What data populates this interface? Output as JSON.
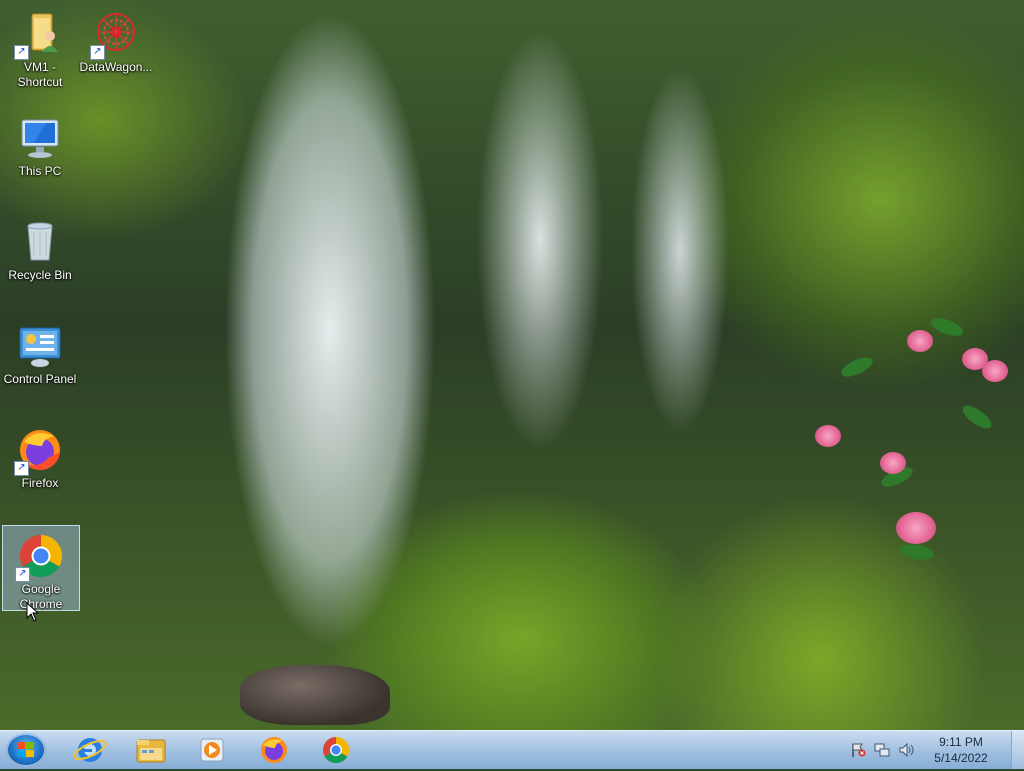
{
  "desktop": {
    "icons": [
      {
        "label": "VM1 - Shortcut",
        "icon": "folder-user-icon",
        "shortcut": true
      },
      {
        "label": "DataWagon...",
        "icon": "datawagon-icon",
        "shortcut": true
      },
      {
        "label": "This PC",
        "icon": "computer-monitor-icon",
        "shortcut": false
      },
      {
        "label": "Recycle Bin",
        "icon": "recycle-bin-icon",
        "shortcut": false
      },
      {
        "label": "Control Panel",
        "icon": "control-panel-icon",
        "shortcut": false
      },
      {
        "label": "Firefox",
        "icon": "firefox-icon",
        "shortcut": true
      },
      {
        "label": "Google Chrome",
        "icon": "chrome-icon",
        "shortcut": true,
        "selected": true
      }
    ]
  },
  "taskbar": {
    "pinned": [
      {
        "name": "internet-explorer",
        "icon": "internet-explorer-icon"
      },
      {
        "name": "file-explorer",
        "icon": "folder-icon"
      },
      {
        "name": "media-player",
        "icon": "media-player-icon"
      },
      {
        "name": "firefox",
        "icon": "firefox-icon"
      },
      {
        "name": "chrome",
        "icon": "chrome-icon"
      }
    ],
    "clock": {
      "time": "9:11 PM",
      "date": "5/14/2022"
    }
  },
  "colors": {
    "taskbar_top": "#c9dcf0",
    "taskbar_bottom": "#87aed6",
    "selection": "#aac8f0"
  }
}
